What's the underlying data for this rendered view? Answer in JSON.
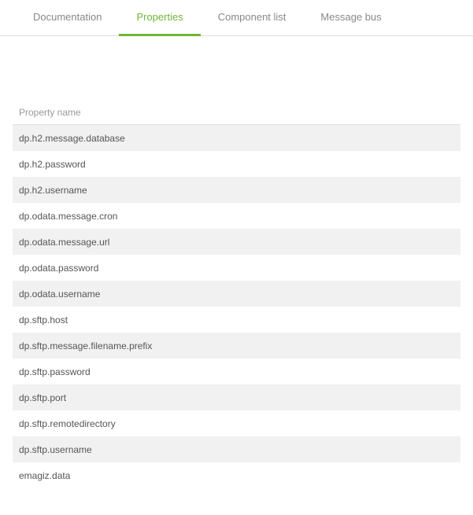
{
  "tabs": [
    {
      "label": "Documentation",
      "active": false
    },
    {
      "label": "Properties",
      "active": true
    },
    {
      "label": "Component list",
      "active": false
    },
    {
      "label": "Message bus",
      "active": false
    }
  ],
  "table": {
    "column_header": "Property name",
    "rows": [
      "dp.h2.message.database",
      "dp.h2.password",
      "dp.h2.username",
      "dp.odata.message.cron",
      "dp.odata.message.url",
      "dp.odata.password",
      "dp.odata.username",
      "dp.sftp.host",
      "dp.sftp.message.filename.prefix",
      "dp.sftp.password",
      "dp.sftp.port",
      "dp.sftp.remotedirectory",
      "dp.sftp.username",
      "emagiz.data"
    ]
  }
}
